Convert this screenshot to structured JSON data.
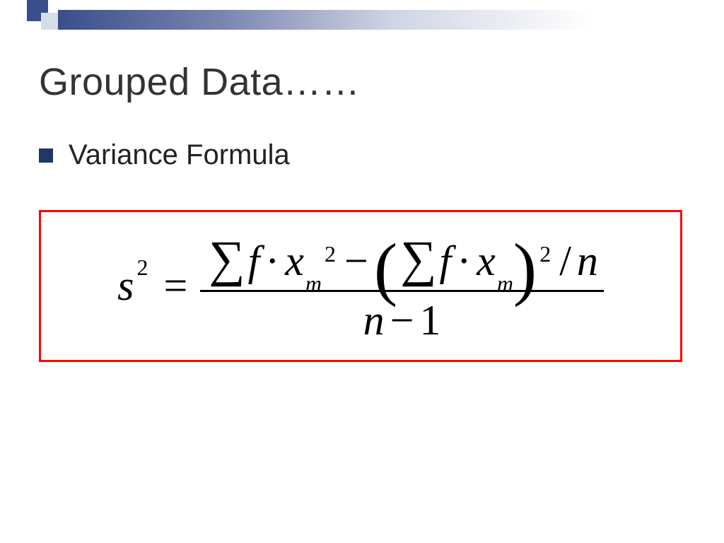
{
  "slide": {
    "title": "Grouped Data……",
    "bullet": "Variance Formula",
    "formula": {
      "lhs_var": "s",
      "lhs_exp": "2",
      "eq": "=",
      "numerator": {
        "sigma1": "∑",
        "f1": "f",
        "dot1": "·",
        "x1": "x",
        "sub1": "m",
        "exp1": "2",
        "minus": "−",
        "lp": "(",
        "sigma2": "∑",
        "f2": "f",
        "dot2": "·",
        "x2": "x",
        "sub2": "m",
        "rp": ")",
        "exp2": "2",
        "slash": "/",
        "n1": "n"
      },
      "denominator": {
        "n": "n",
        "minus": "−",
        "one": "1"
      }
    }
  }
}
